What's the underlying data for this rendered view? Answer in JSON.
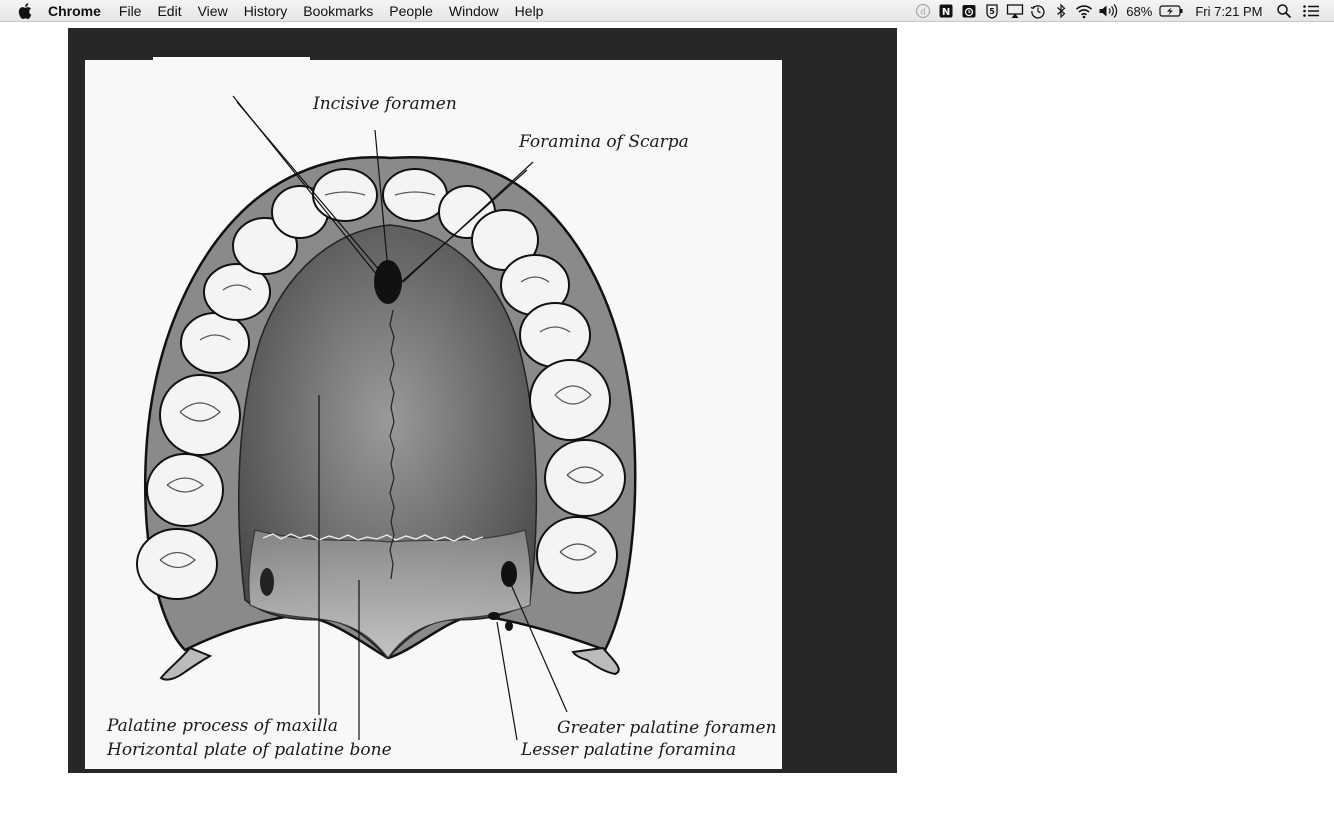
{
  "menubar": {
    "app_name": "Chrome",
    "menus": [
      "File",
      "Edit",
      "View",
      "History",
      "Bookmarks",
      "People",
      "Window",
      "Help"
    ],
    "status_icons": [
      "dashlane-icon",
      "notion-icon",
      "alarm-icon",
      "five-icon",
      "airplay-icon",
      "time-machine-icon",
      "bluetooth-icon",
      "wifi-icon",
      "volume-icon"
    ],
    "battery_percent": "68%",
    "clock": "Fri 7:21 PM"
  },
  "figure": {
    "labels": {
      "incisive_foramen": "Incisive foramen",
      "foramina_of_scarpa": "Foramina of Scarpa",
      "palatine_process": "Palatine process of maxilla",
      "horizontal_plate": "Horizontal plate of palatine bone",
      "greater_palatine": "Greater palatine foramen",
      "lesser_palatine": "Lesser palatine foramina"
    }
  },
  "colors": {
    "menubar_bg": "#ececec",
    "viewer_bg": "#272727",
    "image_bg": "#f8f8f6"
  }
}
